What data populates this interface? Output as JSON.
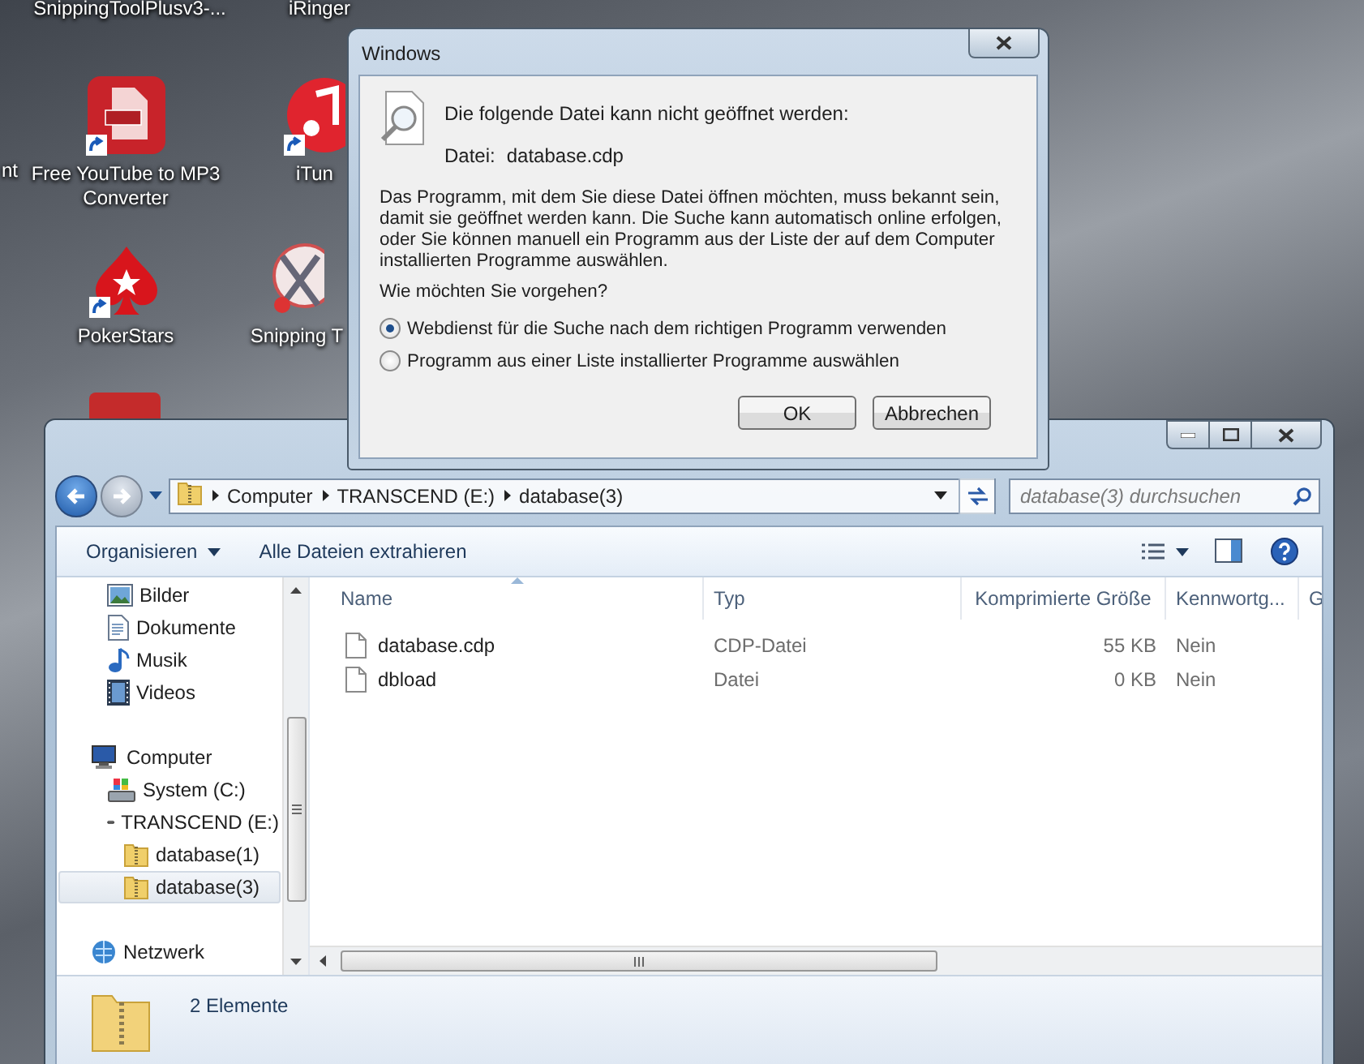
{
  "desktop": {
    "icons": [
      {
        "label": "SnippingToolPlusv3-...",
        "kind": "text-only"
      },
      {
        "label": "iRinger",
        "kind": "text-only"
      },
      {
        "label": "nt",
        "kind": "text-only"
      },
      {
        "label": "Free YouTube to MP3 Converter",
        "kind": "mp3",
        "shortcut": true
      },
      {
        "label": "iTun",
        "kind": "music",
        "shortcut": true
      },
      {
        "label": "PokerStars",
        "kind": "spade",
        "shortcut": true
      },
      {
        "label": "Snipping T",
        "kind": "scissors",
        "shortcut": false
      },
      {
        "kind": "document"
      }
    ]
  },
  "explorer": {
    "breadcrumb": [
      "Computer",
      "TRANSCEND (E:)",
      "database(3)"
    ],
    "search": {
      "placeholder": "database(3) durchsuchen"
    },
    "toolbar": [
      {
        "label": "Organisieren",
        "kind": "menu"
      },
      {
        "label": "Alle Dateien extrahieren",
        "kind": "button"
      }
    ],
    "nav_pane": {
      "libraries": [
        {
          "label": "Bilder",
          "kind": "pictures",
          "selected": false
        },
        {
          "label": "Dokumente",
          "kind": "documents",
          "selected": false
        },
        {
          "label": "Musik",
          "kind": "music",
          "selected": false
        },
        {
          "label": "Videos",
          "kind": "videos",
          "selected": false
        }
      ],
      "tree": [
        {
          "label": "Computer",
          "kind": "computer",
          "selected": false,
          "children": [
            {
              "label": "System (C:)",
              "kind": "system-drive",
              "selected": false
            },
            {
              "label": "TRANSCEND (E:)",
              "kind": "usb-drive",
              "selected": false,
              "children": [
                {
                  "label": "database(1)",
                  "kind": "zip-folder",
                  "selected": false
                },
                {
                  "label": "database(3)",
                  "kind": "zip-folder",
                  "selected": true
                }
              ]
            }
          ]
        }
      ],
      "network": {
        "label": "Netzwerk",
        "kind": "network",
        "selected": false
      }
    },
    "columns": [
      {
        "label": "Name",
        "sorted": true
      },
      {
        "label": "Typ",
        "sorted": false
      },
      {
        "label": "Komprimierte Größe",
        "sorted": false
      },
      {
        "label": "Kennwortg...",
        "sorted": false
      },
      {
        "label": "G",
        "sorted": false
      }
    ],
    "rows": [
      {
        "cells": [
          "database.cdp",
          "CDP-Datei",
          "55 KB",
          "Nein"
        ]
      },
      {
        "cells": [
          "dbload",
          "Datei",
          "0 KB",
          "Nein"
        ]
      }
    ],
    "status": "2 Elemente"
  },
  "dialog": {
    "title": "Windows",
    "heading": "Die folgende Datei kann nicht geöffnet werden:",
    "file_label": "Datei:",
    "file_name": "database.cdp",
    "message": "Das Programm, mit dem Sie diese Datei öffnen möchten, muss bekannt sein, damit sie geöffnet werden kann. Die Suche kann automatisch online erfolgen, oder Sie können manuell ein Programm aus der Liste der auf dem Computer installierten Programme auswählen.",
    "question": "Wie möchten Sie vorgehen?",
    "options": [
      {
        "label": "Webdienst für die Suche nach dem richtigen Programm verwenden",
        "selected": true
      },
      {
        "label": "Programm aus einer Liste installierter Programme auswählen",
        "selected": false
      }
    ],
    "buttons": [
      "OK",
      "Abbrechen"
    ]
  }
}
